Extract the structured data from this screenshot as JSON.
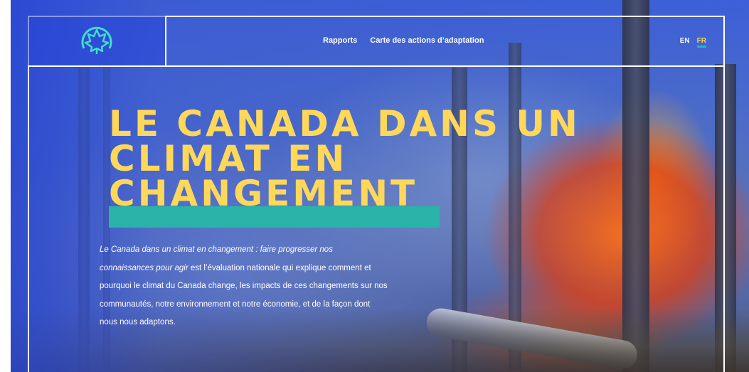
{
  "nav": {
    "items": [
      "Rapports",
      "Carte des actions d’adaptation"
    ]
  },
  "language": {
    "en": "EN",
    "fr": "FR",
    "active": "FR"
  },
  "hero": {
    "title_lines": [
      "LE CANADA DANS UN",
      "CLIMAT EN",
      "CHANGEMENT"
    ],
    "description_italic": "Le Canada dans un climat en changement : faire progresser nos connaissances pour agir",
    "description_rest": " est l’évaluation nationale qui explique comment et pourquoi le climat du Canada change, les impacts de ces changements sur nos communautés, notre environnement et notre économie, et de la façon dont nous nous adaptons."
  },
  "colors": {
    "accent_yellow": "#ffd85a",
    "accent_teal": "#2ab3a8",
    "brand_blue": "#2846d7"
  },
  "icons": {
    "logo": "maple-leaf-logo-icon"
  }
}
